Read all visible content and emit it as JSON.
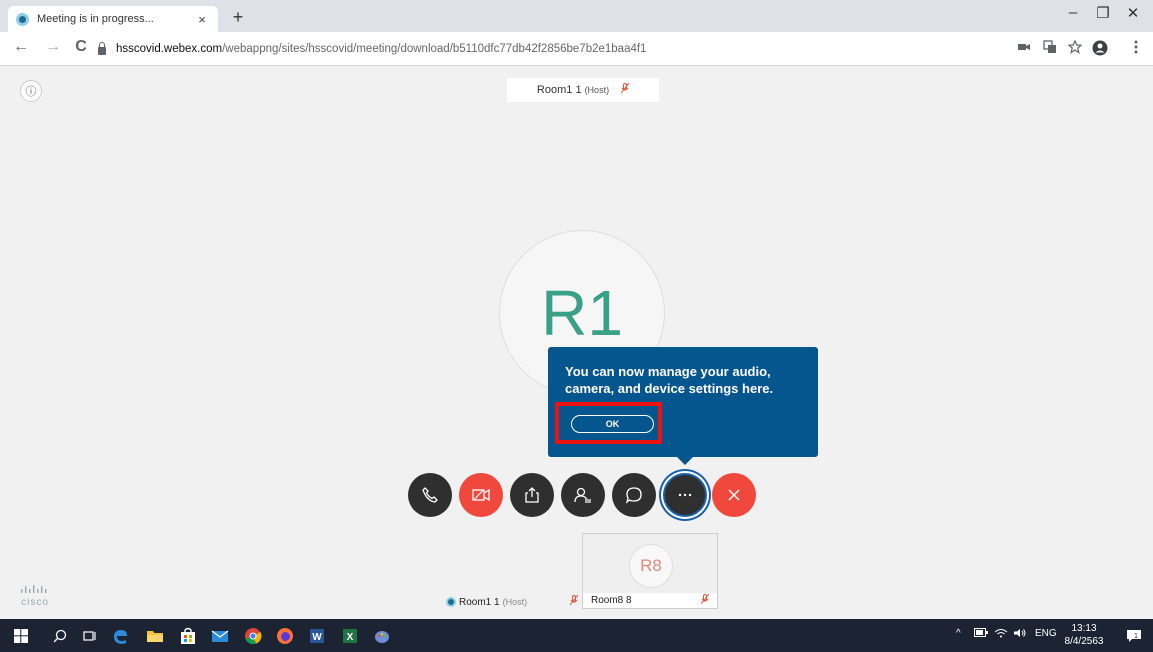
{
  "browser": {
    "tab_title": "Meeting is in progress...",
    "tab_close": "×",
    "new_tab": "+",
    "url_host": "hsscovid.webex.com",
    "url_path": "/webappng/sites/hsscovid/meeting/download/b5110dfc77db42f2856be7b2e1baa4f1",
    "window_minimize": "–",
    "window_restore": "❐",
    "window_close": "✕",
    "back": "←",
    "forward": "→",
    "reload": "C"
  },
  "meeting": {
    "info_icon": "ⓘ",
    "active_speaker": {
      "name": "Room1 1",
      "role": "(Host)"
    },
    "main_avatar_initials": "R1",
    "tooltip": {
      "message": "You can now manage your audio, camera, and device settings here.",
      "ok_label": "OK"
    },
    "self_view": {
      "name": "Room1 1",
      "role": "(Host)"
    },
    "participant_thumb": {
      "initials": "R8",
      "name": "Room8 8"
    },
    "brand": "cisco",
    "controls": [
      {
        "name": "audio-button",
        "icon": "phone-icon",
        "color": "#2f2f2f"
      },
      {
        "name": "video-button",
        "icon": "video-off-icon",
        "color": "#f0483c"
      },
      {
        "name": "share-button",
        "icon": "share-icon",
        "color": "#2f2f2f"
      },
      {
        "name": "participants-button",
        "icon": "participants-icon",
        "color": "#2f2f2f"
      },
      {
        "name": "chat-button",
        "icon": "chat-icon",
        "color": "#2f2f2f"
      },
      {
        "name": "more-button",
        "icon": "more-icon",
        "color": "#2f2f2f"
      },
      {
        "name": "leave-button",
        "icon": "close-icon",
        "color": "#f0483c"
      }
    ]
  },
  "taskbar": {
    "language": "ENG",
    "time": "13:13",
    "date": "8/4/2563",
    "notification_count": "1"
  }
}
